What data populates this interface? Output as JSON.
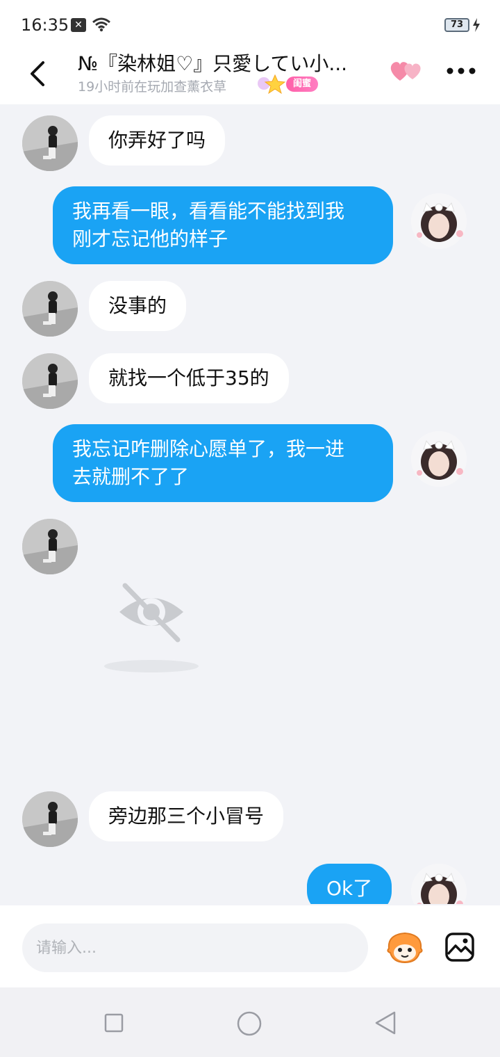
{
  "status_bar": {
    "time": "16:35",
    "battery": "73"
  },
  "header": {
    "back_icon": "chevron-left-icon",
    "title": "№『染林姐♡』只愛してい小...",
    "subtitle": "19小时前在玩加查薰衣草",
    "badge": "闺蜜",
    "hearts_icon": "hearts-icon",
    "more_icon": "more-horizontal-icon"
  },
  "messages": [
    {
      "side": "left",
      "text": "你弄好了吗"
    },
    {
      "side": "right",
      "text_lines": [
        "我再看一眼，看看能不能找到我",
        "刚才忘记他的样子"
      ]
    },
    {
      "side": "left",
      "text": "没事的"
    },
    {
      "side": "left",
      "text": "就找一个低于35的"
    },
    {
      "side": "right",
      "text_lines": [
        "我忘记咋删除心愿单了，我一进",
        "去就删不了了"
      ]
    },
    {
      "side": "left",
      "type": "hidden-image",
      "icon": "eye-off-icon"
    },
    {
      "side": "left",
      "text": "旁边那三个小冒号"
    },
    {
      "side": "right",
      "text": "Ok了"
    }
  ],
  "input": {
    "placeholder": "请输入..."
  },
  "colors": {
    "accent": "#1aa3f4",
    "background": "#f2f3f7",
    "badge": "#ff5fa8"
  }
}
